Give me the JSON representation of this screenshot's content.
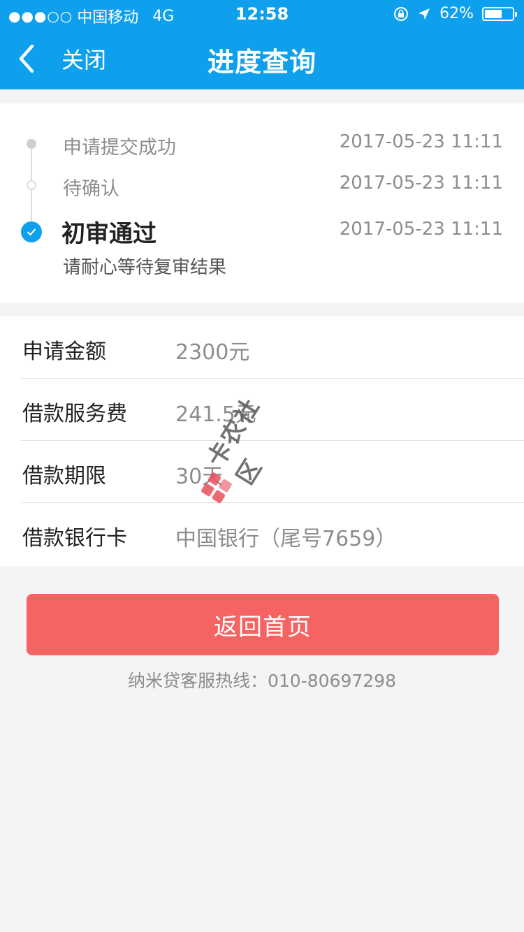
{
  "status_bar": {
    "signal_dots": "●●●○○",
    "carrier": "中国移动",
    "network": "4G",
    "time": "12:58",
    "battery_percent": "62%",
    "battery_level": 0.62
  },
  "nav": {
    "back_label": "关闭",
    "title": "进度查询"
  },
  "timeline": {
    "steps": [
      {
        "label": "申请提交成功",
        "date": "2017-05-23 11:11"
      },
      {
        "label": "待确认",
        "date": "2017-05-23 11:11"
      },
      {
        "label": "初审通过",
        "date": "2017-05-23 11:11",
        "sub": "请耐心等待复审结果"
      }
    ]
  },
  "details": [
    {
      "key": "申请金额",
      "value": "2300元"
    },
    {
      "key": "借款服务费",
      "value": "241.5元"
    },
    {
      "key": "借款期限",
      "value": "30天"
    },
    {
      "key": "借款银行卡",
      "value": "中国银行（尾号7659）"
    }
  ],
  "home_button": "返回首页",
  "hotline": "纳米贷客服热线：010-80697298",
  "watermark": "卡农社区",
  "colors": {
    "brand_blue": "#0ea0ec",
    "button_red": "#f56463"
  }
}
